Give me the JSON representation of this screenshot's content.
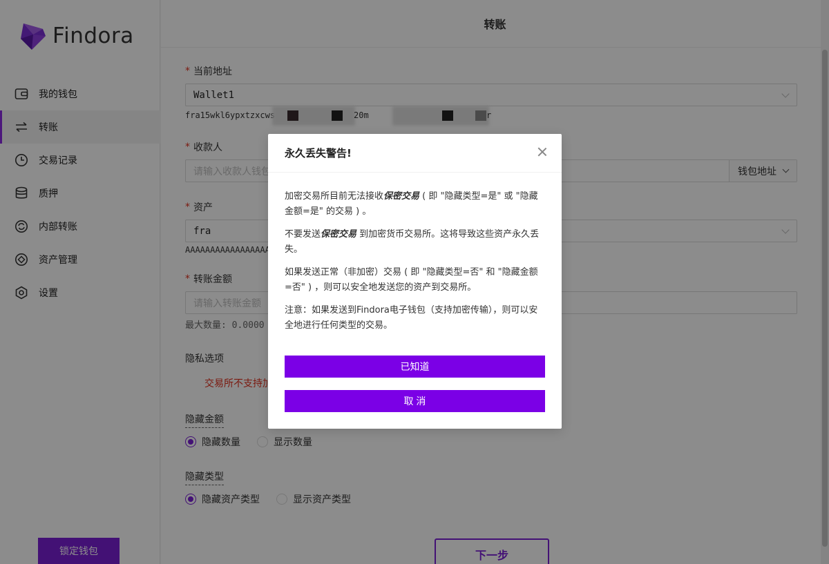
{
  "brand": {
    "name": "Findora",
    "accent": "#7b1fd6",
    "logo_color": "#8a2be2"
  },
  "sidebar": {
    "items": [
      {
        "label": "我的钱包",
        "icon": "wallet-icon"
      },
      {
        "label": "转账",
        "icon": "transfer-icon",
        "active": true
      },
      {
        "label": "交易记录",
        "icon": "clock-icon"
      },
      {
        "label": "质押",
        "icon": "database-icon"
      },
      {
        "label": "内部转账",
        "icon": "sync-icon"
      },
      {
        "label": "资产管理",
        "icon": "asset-icon"
      },
      {
        "label": "设置",
        "icon": "settings-icon"
      }
    ],
    "lock_button": "锁定钱包"
  },
  "page": {
    "title": "转账"
  },
  "form": {
    "current_address": {
      "label": "当前地址",
      "value": "Wallet1",
      "address_start": "fra15wkl6ypxtzxcws",
      "address_mid": "20m",
      "address_end": "r"
    },
    "recipient": {
      "label": "收款人",
      "placeholder": "请输入收款人钱包",
      "addon": "钱包地址"
    },
    "asset": {
      "label": "资产",
      "value": "fra",
      "code": "AAAAAAAAAAAAAAAAA"
    },
    "amount": {
      "label": "转账金额",
      "placeholder": "请输入转账金额",
      "max_hint": "最大数量: 0.0000"
    },
    "privacy": {
      "title": "隐私选项",
      "warning": "交易所不支持加"
    },
    "hide_amount": {
      "title": "隐藏金额",
      "option_on": "隐藏数量",
      "option_off": "显示数量",
      "selected": "on"
    },
    "hide_type": {
      "title": "隐藏类型",
      "option_on": "隐藏资产类型",
      "option_off": "显示资产类型",
      "selected": "on"
    },
    "next_button": "下一步"
  },
  "modal": {
    "title": "永久丢失警告!",
    "p1_a": "加密交易所目前无法接收",
    "p1_b": "保密交易",
    "p1_c": "( 即 \"隐藏类型=是\" 或 \"隐藏金额=是\" 的交易 ) 。",
    "p2_a": "不要发送",
    "p2_b": "保密交易",
    "p2_c": " 到加密货币交易所。这将导致这些资产永久丢失。",
    "p3": "如果发送正常（非加密）交易 ( 即 \"隐藏类型=否\" 和 \"隐藏金额=否\" ) ，则可以安全地发送您的资产到交易所。",
    "p4": "注意：如果发送到Findora电子钱包（支持加密传输），则可以安全地进行任何类型的交易。",
    "confirm_button": "已知道",
    "cancel_button": "取 消"
  }
}
